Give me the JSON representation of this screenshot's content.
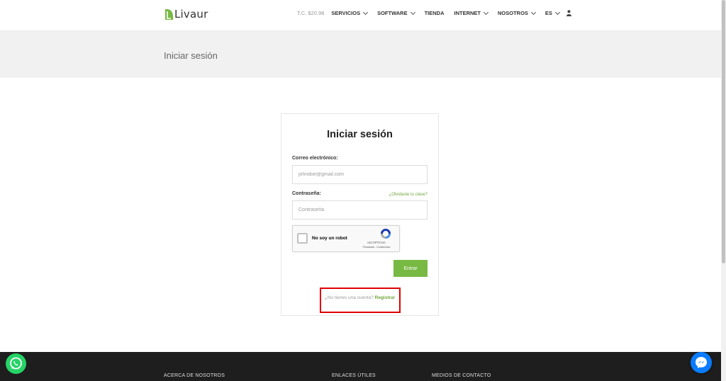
{
  "header": {
    "brand": "Livaur",
    "exchange_rate": "T.C. $20.98",
    "nav": {
      "servicios": "SERVICIOS",
      "software": "SOFTWARE",
      "tienda": "TIENDA",
      "internet": "INTERNET",
      "nosotros": "NOSOTROS",
      "language": "ES"
    }
  },
  "page": {
    "title": "Iniciar sesión"
  },
  "login": {
    "heading": "Iniciar sesión",
    "email_label": "Correo electrónico:",
    "email_placeholder": "johndoe@gmail.com",
    "password_label": "Contraseña:",
    "forgot_link": "¿Olvidaste tu clave?",
    "password_placeholder": "Contraseña",
    "recaptcha_label": "No soy un robot",
    "recaptcha_brand": "reCAPTCHA",
    "recaptcha_terms": "Privacidad - Condiciones",
    "submit_label": "Entrar",
    "signup_prompt": "¿No tienes una cuenta?",
    "signup_link": "Registrar"
  },
  "footer": {
    "about": "ACERCA DE NOSOTROS",
    "links": "ENLACES ÚTILES",
    "contact": "MEDIOS DE CONTACTO"
  },
  "colors": {
    "accent_green": "#78b944",
    "highlight_red": "#e00000",
    "whatsapp_green": "#25d366",
    "messenger_blue": "#0a7cff",
    "footer_bg": "#1e1e1e"
  },
  "icons": [
    "leaf-logo-icon",
    "chevron-down-icon",
    "user-icon",
    "recaptcha-icon",
    "whatsapp-icon",
    "messenger-icon"
  ]
}
